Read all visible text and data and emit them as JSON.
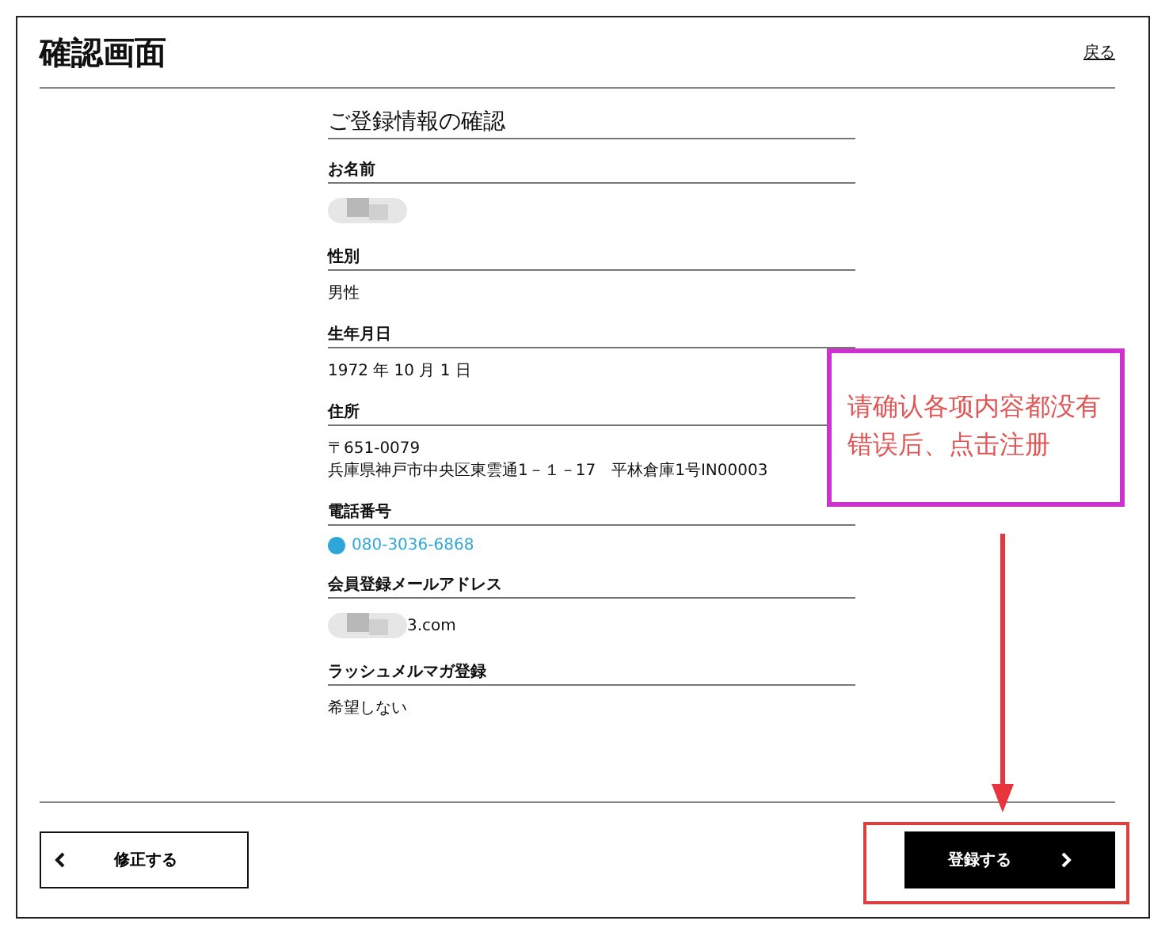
{
  "header": {
    "title": "確認画面",
    "back_link": "戻る"
  },
  "section_title": "ご登録情報の確認",
  "fields": [
    {
      "label": "お名前",
      "kind": "blurred"
    },
    {
      "label": "性別",
      "kind": "text",
      "lines": [
        "男性"
      ]
    },
    {
      "label": "生年月日",
      "kind": "text",
      "lines": [
        "1972 年 10 月 1 日"
      ]
    },
    {
      "label": "住所",
      "kind": "text",
      "lines": [
        "〒651-0079",
        "兵庫県神戸市中央区東雲通1－１－17　平林倉庫1号IN00003"
      ]
    },
    {
      "label": "電話番号",
      "kind": "phone",
      "lines": [
        "080-3036-6868"
      ]
    },
    {
      "label": "会員登録メールアドレス",
      "kind": "blurred",
      "lines": [
        "3.com"
      ]
    },
    {
      "label": "ラッシュメルマガ登録",
      "kind": "text",
      "lines": [
        "希望しない"
      ]
    }
  ],
  "buttons": {
    "back": "修正する",
    "submit": "登録する"
  },
  "annotation": {
    "note": "请确认各项内容都没有错误后、点击注册"
  }
}
